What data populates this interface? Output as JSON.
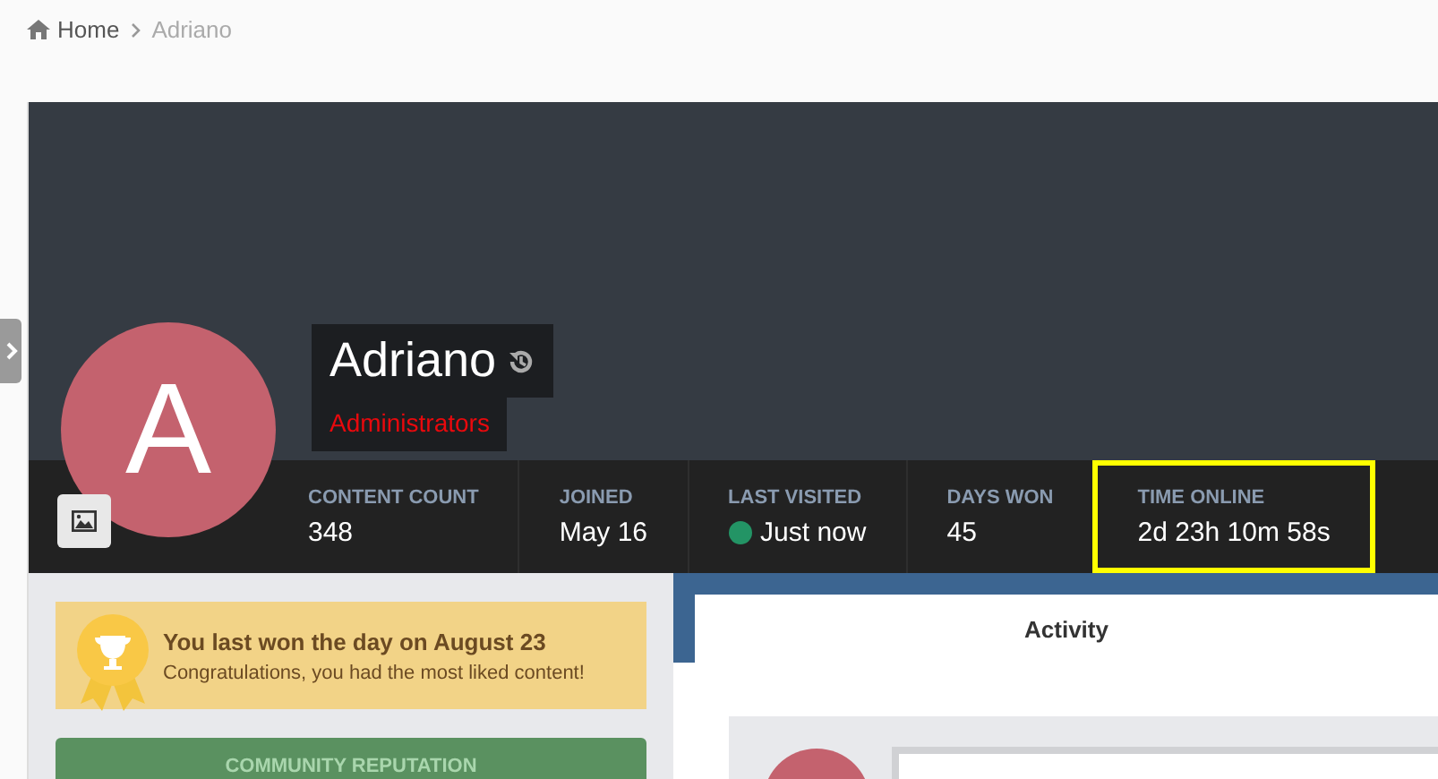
{
  "breadcrumb": [
    {
      "label": "Home",
      "kind": "home"
    },
    {
      "label": "Adriano",
      "kind": "current"
    }
  ],
  "profile": {
    "name": "Adriano",
    "avatar_letter": "A",
    "group": "Administrators"
  },
  "stats": [
    {
      "label": "CONTENT COUNT",
      "value": "348",
      "highlighted": false
    },
    {
      "label": "JOINED",
      "value": "May 16",
      "highlighted": false
    },
    {
      "label": "LAST VISITED",
      "value": "Just now",
      "online": true,
      "highlighted": false
    },
    {
      "label": "DAYS WON",
      "value": "45",
      "highlighted": false
    },
    {
      "label": "TIME ONLINE",
      "value": "2d 23h 10m 58s",
      "highlighted": true
    }
  ],
  "day_won": {
    "title": "You last won the day on August 23",
    "text": "Congratulations, you had the most liked content!"
  },
  "reputation": {
    "title": "COMMUNITY REPUTATION"
  },
  "tabs": [
    {
      "label": "Activity",
      "selected": true
    }
  ]
}
